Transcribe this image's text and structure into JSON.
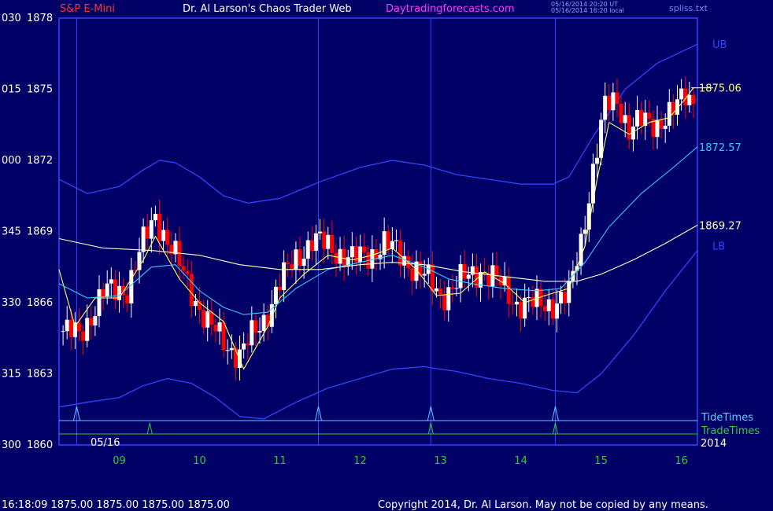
{
  "header": {
    "instrument": "S&P E-Mini",
    "title": "Dr. Al Larson's Chaos Trader Web",
    "site": "Daytradingforecasts.com",
    "ut_time": "05/16/2014 20:20 UT",
    "local_time": "05/16/2014 16:20 local",
    "file": "spliss.txt"
  },
  "colors": {
    "background": "#000066",
    "up_bar": "#ffffff",
    "down_bar": "#ff0000",
    "band": "#3344ff",
    "avg_yellow": "#ffff66",
    "avg_cyan": "#33ccff",
    "avg_cream": "#ffffcc",
    "tide": "#66ccff",
    "trade": "#33cc33"
  },
  "footer": {
    "quote": "16:18:09  1875.00 1875.00 1875.00 1875.00",
    "copyright": "Copyright 2014, Dr. Al Larson. May not be copied by any means."
  },
  "chart_data": {
    "type": "candlestick",
    "title": "S&P E-Mini",
    "x_ticks": [
      "09",
      "10",
      "11",
      "12",
      "13",
      "14",
      "15",
      "16"
    ],
    "x_range": [
      8.25,
      16.2
    ],
    "date_label": "05/16",
    "year_label": "2014",
    "y_range": [
      1860,
      1878
    ],
    "y_ticks": [
      {
        "value": 1878,
        "left": "030",
        "right": "1878"
      },
      {
        "value": 1875,
        "left": "015",
        "right": "1875"
      },
      {
        "value": 1872,
        "left": "000",
        "right": "1872"
      },
      {
        "value": 1869,
        "left": "345",
        "right": "1869"
      },
      {
        "value": 1866,
        "left": "330",
        "right": "1866"
      },
      {
        "value": 1863,
        "left": "315",
        "right": "1863"
      },
      {
        "value": 1860,
        "left": "300",
        "right": "1860"
      }
    ],
    "right_labels": [
      {
        "text": "UB",
        "value": 1876.9,
        "color": "#3344ff"
      },
      {
        "text": "1875.06",
        "value": 1875.06,
        "color": "#ffff66"
      },
      {
        "text": "1872.57",
        "value": 1872.57,
        "color": "#33ccff"
      },
      {
        "text": "1869.27",
        "value": 1869.27,
        "color": "#ffffcc"
      },
      {
        "text": "LB",
        "value": 1868.4,
        "color": "#3344ff"
      }
    ],
    "vertical_lines": [
      8.47,
      11.48,
      12.88,
      14.43
    ],
    "tide_times": [
      8.47,
      11.48,
      12.88,
      14.43
    ],
    "trade_times": [
      9.38,
      12.88,
      14.43
    ],
    "timing_labels": {
      "tide": "TideTimes",
      "trade": "TradeTimes"
    },
    "price_path": [
      [
        8.3,
        1864.8
      ],
      [
        8.5,
        1864.6
      ],
      [
        8.6,
        1865.2
      ],
      [
        8.8,
        1866.4
      ],
      [
        9.1,
        1866.6
      ],
      [
        9.3,
        1868.5
      ],
      [
        9.45,
        1869.7
      ],
      [
        9.6,
        1868.6
      ],
      [
        9.9,
        1866.5
      ],
      [
        10.1,
        1865.1
      ],
      [
        10.35,
        1864.2
      ],
      [
        10.5,
        1863.8
      ],
      [
        10.8,
        1865.3
      ],
      [
        11.0,
        1866.8
      ],
      [
        11.2,
        1867.9
      ],
      [
        11.4,
        1868.6
      ],
      [
        11.6,
        1868.4
      ],
      [
        11.9,
        1867.8
      ],
      [
        12.1,
        1868.0
      ],
      [
        12.3,
        1868.5
      ],
      [
        12.5,
        1868.0
      ],
      [
        12.8,
        1867.1
      ],
      [
        13.0,
        1866.3
      ],
      [
        13.2,
        1866.8
      ],
      [
        13.5,
        1867.4
      ],
      [
        13.7,
        1866.9
      ],
      [
        13.95,
        1866.0
      ],
      [
        14.2,
        1865.9
      ],
      [
        14.4,
        1866.0
      ],
      [
        14.6,
        1866.3
      ],
      [
        14.75,
        1868.6
      ],
      [
        14.9,
        1871.6
      ],
      [
        15.05,
        1874.2
      ],
      [
        15.2,
        1874.6
      ],
      [
        15.35,
        1873.3
      ],
      [
        15.5,
        1873.6
      ],
      [
        15.7,
        1873.6
      ],
      [
        15.9,
        1874.0
      ],
      [
        16.05,
        1874.8
      ],
      [
        16.15,
        1874.6
      ]
    ],
    "series": [
      {
        "name": "",
        "style": "yellow-average",
        "values": [
          [
            8.25,
            1867.4
          ],
          [
            8.45,
            1865.0
          ],
          [
            8.7,
            1866.2
          ],
          [
            9.0,
            1866.2
          ],
          [
            9.3,
            1867.8
          ],
          [
            9.45,
            1868.8
          ],
          [
            9.75,
            1867.0
          ],
          [
            10.0,
            1866.0
          ],
          [
            10.3,
            1865.2
          ],
          [
            10.55,
            1863.2
          ],
          [
            10.85,
            1865.0
          ],
          [
            11.0,
            1866.2
          ],
          [
            11.3,
            1867.2
          ],
          [
            11.6,
            1868.0
          ],
          [
            11.9,
            1867.8
          ],
          [
            12.15,
            1868.0
          ],
          [
            12.4,
            1868.3
          ],
          [
            12.7,
            1867.4
          ],
          [
            12.95,
            1866.3
          ],
          [
            13.25,
            1866.4
          ],
          [
            13.55,
            1867.3
          ],
          [
            13.8,
            1866.8
          ],
          [
            14.05,
            1866.0
          ],
          [
            14.3,
            1866.3
          ],
          [
            14.6,
            1866.6
          ],
          [
            14.8,
            1868.4
          ],
          [
            14.95,
            1871.2
          ],
          [
            15.1,
            1873.6
          ],
          [
            15.35,
            1873.1
          ],
          [
            15.6,
            1873.6
          ],
          [
            15.85,
            1873.8
          ],
          [
            16.05,
            1874.6
          ],
          [
            16.15,
            1875.06
          ]
        ]
      },
      {
        "name": "",
        "style": "cyan-average",
        "values": [
          [
            8.25,
            1866.8
          ],
          [
            8.6,
            1866.2
          ],
          [
            9.0,
            1866.3
          ],
          [
            9.4,
            1867.5
          ],
          [
            9.7,
            1867.6
          ],
          [
            10.0,
            1866.5
          ],
          [
            10.3,
            1865.8
          ],
          [
            10.55,
            1865.5
          ],
          [
            10.85,
            1865.6
          ],
          [
            11.2,
            1866.6
          ],
          [
            11.6,
            1867.4
          ],
          [
            12.0,
            1867.7
          ],
          [
            12.4,
            1868.0
          ],
          [
            12.8,
            1867.5
          ],
          [
            13.1,
            1867.0
          ],
          [
            13.4,
            1866.8
          ],
          [
            13.8,
            1866.6
          ],
          [
            14.2,
            1866.5
          ],
          [
            14.5,
            1866.6
          ],
          [
            14.8,
            1867.7
          ],
          [
            15.1,
            1869.2
          ],
          [
            15.5,
            1870.6
          ],
          [
            15.9,
            1871.7
          ],
          [
            16.2,
            1872.57
          ]
        ]
      },
      {
        "name": "",
        "style": "cream-average",
        "values": [
          [
            8.25,
            1868.7
          ],
          [
            8.8,
            1868.3
          ],
          [
            9.4,
            1868.2
          ],
          [
            10.0,
            1868.0
          ],
          [
            10.5,
            1867.6
          ],
          [
            11.0,
            1867.4
          ],
          [
            11.5,
            1867.4
          ],
          [
            12.0,
            1867.6
          ],
          [
            12.4,
            1867.7
          ],
          [
            12.8,
            1867.6
          ],
          [
            13.3,
            1867.3
          ],
          [
            13.8,
            1867.1
          ],
          [
            14.3,
            1866.9
          ],
          [
            14.7,
            1866.9
          ],
          [
            15.0,
            1867.2
          ],
          [
            15.4,
            1867.8
          ],
          [
            15.8,
            1868.5
          ],
          [
            16.2,
            1869.27
          ]
        ]
      },
      {
        "name": "",
        "style": "upper-band",
        "values": [
          [
            8.25,
            1871.2
          ],
          [
            8.6,
            1870.6
          ],
          [
            9.0,
            1870.9
          ],
          [
            9.3,
            1871.6
          ],
          [
            9.5,
            1872.0
          ],
          [
            9.7,
            1871.9
          ],
          [
            10.0,
            1871.3
          ],
          [
            10.3,
            1870.5
          ],
          [
            10.6,
            1870.2
          ],
          [
            11.0,
            1870.4
          ],
          [
            11.5,
            1871.1
          ],
          [
            12.0,
            1871.7
          ],
          [
            12.4,
            1872.0
          ],
          [
            12.8,
            1871.8
          ],
          [
            13.2,
            1871.4
          ],
          [
            13.6,
            1871.2
          ],
          [
            14.0,
            1871.0
          ],
          [
            14.4,
            1871.0
          ],
          [
            14.6,
            1871.3
          ],
          [
            14.9,
            1873.0
          ],
          [
            15.3,
            1875.0
          ],
          [
            15.7,
            1876.1
          ],
          [
            16.2,
            1876.9
          ]
        ]
      },
      {
        "name": "",
        "style": "lower-band",
        "values": [
          [
            8.25,
            1861.6
          ],
          [
            8.6,
            1861.8
          ],
          [
            9.0,
            1862.0
          ],
          [
            9.3,
            1862.5
          ],
          [
            9.6,
            1862.8
          ],
          [
            9.9,
            1862.6
          ],
          [
            10.2,
            1862.0
          ],
          [
            10.5,
            1861.2
          ],
          [
            10.8,
            1861.1
          ],
          [
            11.2,
            1861.8
          ],
          [
            11.6,
            1862.4
          ],
          [
            12.0,
            1862.8
          ],
          [
            12.4,
            1863.2
          ],
          [
            12.8,
            1863.3
          ],
          [
            13.2,
            1863.1
          ],
          [
            13.6,
            1862.8
          ],
          [
            14.0,
            1862.6
          ],
          [
            14.4,
            1862.3
          ],
          [
            14.7,
            1862.2
          ],
          [
            15.0,
            1863.0
          ],
          [
            15.4,
            1864.6
          ],
          [
            15.8,
            1866.5
          ],
          [
            16.2,
            1868.2
          ]
        ]
      }
    ]
  }
}
